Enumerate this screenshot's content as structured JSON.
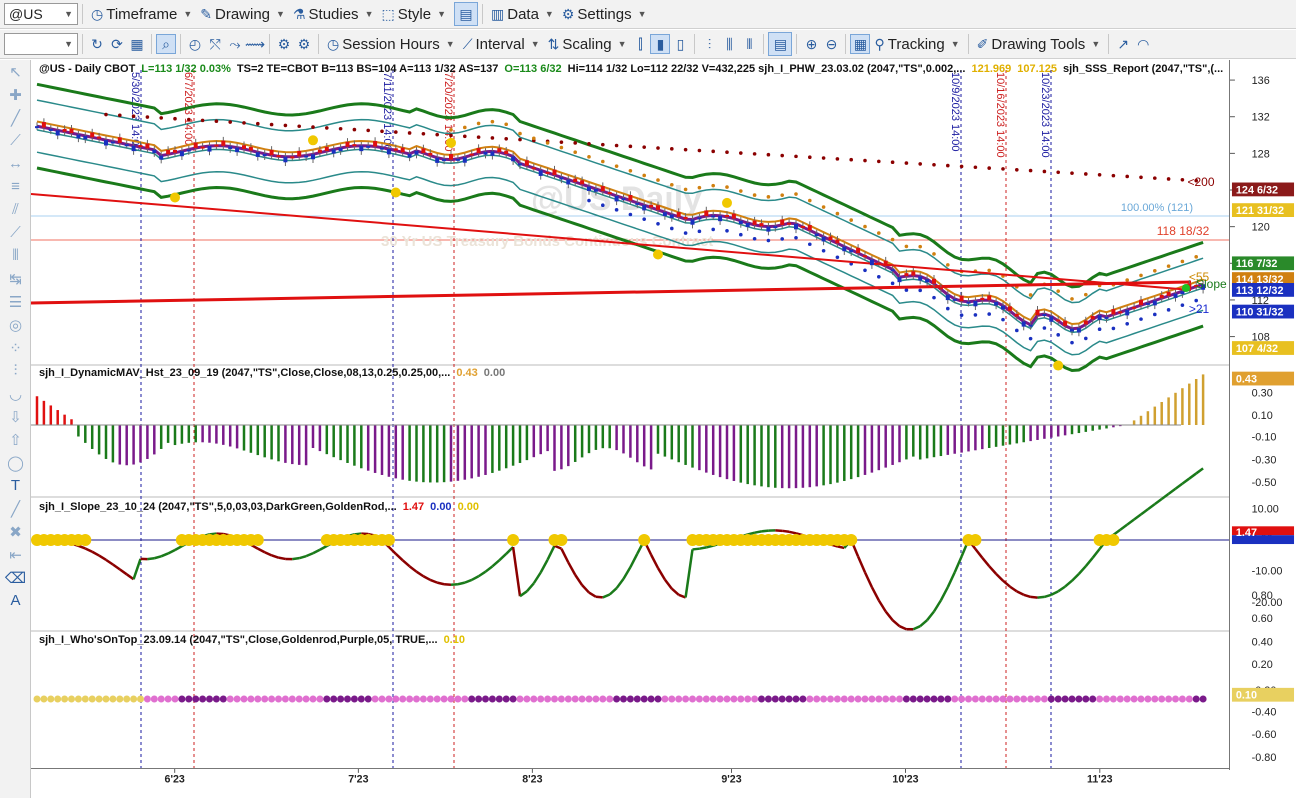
{
  "toolbar1": {
    "symbol": "@US",
    "items": [
      {
        "id": "timeframe",
        "icon": "clock",
        "label": "Timeframe"
      },
      {
        "id": "drawing",
        "icon": "pencil",
        "label": "Drawing"
      },
      {
        "id": "studies",
        "icon": "flask",
        "label": "Studies"
      },
      {
        "id": "style",
        "icon": "dashed-box",
        "label": "Style"
      },
      {
        "id": "data",
        "icon": "bars",
        "label": "Data"
      },
      {
        "id": "settings",
        "icon": "gear",
        "label": "Settings"
      }
    ]
  },
  "toolbar2": {
    "combo_value": "",
    "session_hours": "Session Hours",
    "interval": "Interval",
    "scaling": "Scaling",
    "tracking": "Tracking",
    "drawing_tools": "Drawing Tools"
  },
  "main_info": {
    "symbol": "@US - Daily  CBOT",
    "l": "L=113  1/32  0.03%",
    "rest": "TS=2  TE=CBOT  B=113  BS=104  A=113 1/32  AS=137",
    "o": "O=113 6/32",
    "rest2": "Hi=114 1/32  Lo=112 22/32  V=432,225  sjh_I_PHW_23.03.02 (2047,\"TS\",0.002,...",
    "v1": "121.969",
    "v2": "107.125",
    "rest3": "sjh_SSS_Report (2047,\"TS\",(..."
  },
  "watermark": {
    "big": "@US Daily",
    "small": "30 Yr US Treasury Bonds Continuous Contract"
  },
  "price_labels": [
    {
      "text": "<200",
      "color": "#8b0000"
    },
    {
      "text": "100.00% (121)",
      "color": "#6aa8d8"
    },
    {
      "text": "118 18/32",
      "color": "#e0402a"
    },
    {
      "text": "<55",
      "color": "#cc8800"
    },
    {
      "text": "Slope",
      "color": "#1a7a1a"
    },
    {
      "text": ">21",
      "color": "#1a2ad0"
    }
  ],
  "price_badges": [
    {
      "text": "124 6/32",
      "bg": "#8b1a1a"
    },
    {
      "text": "121 31/32",
      "bg": "#e8c020"
    },
    {
      "text": "116 7/32",
      "bg": "#2a8a2a"
    },
    {
      "text": "114 13/32",
      "bg": "#d08010"
    },
    {
      "text": "113 12/32",
      "bg": "#1a30c0"
    },
    {
      "text": "110 31/32",
      "bg": "#1a30c0"
    },
    {
      "text": "107 4/32",
      "bg": "#e8c020"
    }
  ],
  "price_axis": [
    "136",
    "132",
    "128",
    "124",
    "120",
    "116",
    "112",
    "108"
  ],
  "vlines": [
    {
      "label": "5/30/2023 14:00",
      "color": "#1a1aa0"
    },
    {
      "label": "6/7/2023 14:00",
      "color": "#cc2020"
    },
    {
      "label": "7/11/2023 14:00",
      "color": "#1a1aa0"
    },
    {
      "label": "7/20/2023 14:00",
      "color": "#cc2020"
    },
    {
      "label": "10/9/2023 14:00",
      "color": "#1a1aa0"
    },
    {
      "label": "10/16/2023 14:00",
      "color": "#cc2020"
    },
    {
      "label": "10/23/2023 14:00",
      "color": "#1a1aa0"
    }
  ],
  "panel2": {
    "title": "sjh_I_DynamicMAV_Hst_23_09_19 (2047,\"TS\",Close,Close,08,13,0.25,0.25,00,...",
    "v1": "0.43",
    "v2": "0.00",
    "badge": "0.43",
    "axis": [
      "0.30",
      "0.10",
      "-0.10",
      "-0.30",
      "-0.50"
    ]
  },
  "panel3": {
    "title": "sjh_I_Slope_23_10_24 (2047,\"TS\",5,0,03,03,DarkGreen,GoldenRod,...",
    "v1": "1.47",
    "v2": "0.00",
    "v3": "0.00",
    "badge": "1.47",
    "axis": [
      "10.00",
      "0.00",
      "-10.00",
      "-20.00"
    ]
  },
  "panel4": {
    "title": "sjh_I_Who'sOnTop_23.09.14 (2047,\"TS\",Close,Goldenrod,Purple,05,  TRUE,...",
    "v1": "0.10",
    "badge": "0.10",
    "axis": [
      "0.80",
      "0.60",
      "0.40",
      "0.20",
      "-0.20",
      "-0.40",
      "-0.60",
      "-0.80"
    ]
  },
  "x_axis": [
    "6'23",
    "7'23",
    "8'23",
    "9'23",
    "10'23",
    "11'23"
  ],
  "left_tools": [
    "cursor",
    "crosshair",
    "line",
    "ray",
    "horizontal",
    "fib",
    "channel",
    "trend",
    "bars",
    "measure",
    "levels",
    "cycle",
    "spiral",
    "fan",
    "arc-down",
    "arrow-down",
    "arrow-up",
    "ellipse",
    "text",
    "line2",
    "delete",
    "back",
    "eraser",
    "text-tool"
  ],
  "colors": {
    "green": "#1a7a1a",
    "purple": "#7a1a8a",
    "red": "#e01010",
    "blue": "#1a30c0",
    "gold": "#f0c800",
    "darkred": "#8b0000",
    "teal": "#2a8a8a",
    "orange": "#d08010"
  }
}
